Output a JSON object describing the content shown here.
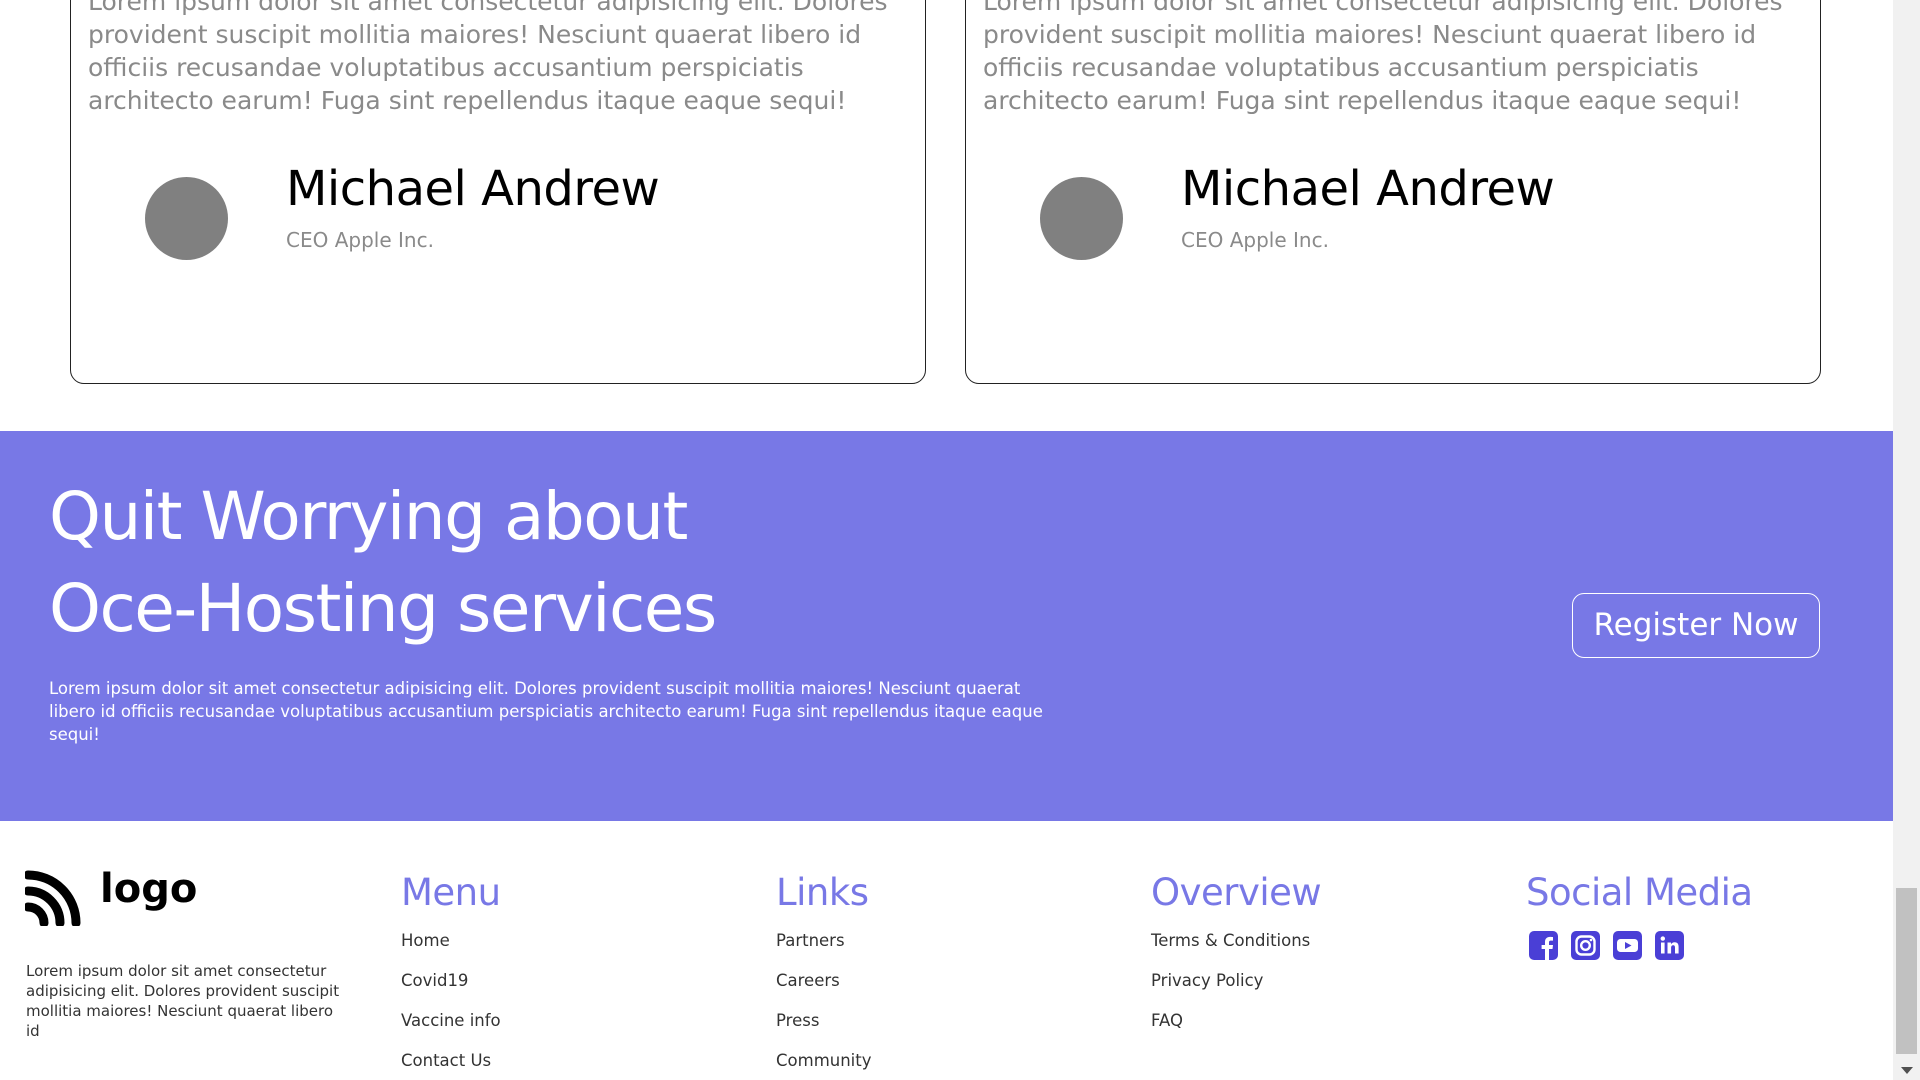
{
  "testimonials": [
    {
      "quote": "Lorem ipsum dolor sit amet consectetur adipisicing elit. Dolores provident suscipit mollitia maiores! Nesciunt quaerat libero id officiis recusandae voluptatibus accusantium perspiciatis architecto earum! Fuga sint repellendus itaque eaque sequi!",
      "name": "Michael Andrew",
      "role": "CEO Apple Inc."
    },
    {
      "quote": "Lorem ipsum dolor sit amet consectetur adipisicing elit. Dolores provident suscipit mollitia maiores! Nesciunt quaerat libero id officiis recusandae voluptatibus accusantium perspiciatis architecto earum! Fuga sint repellendus itaque eaque sequi!",
      "name": "Michael Andrew",
      "role": "CEO Apple Inc."
    }
  ],
  "cta": {
    "heading_line1": "Quit Worrying about",
    "heading_line2": "Oce-Hosting services",
    "description": "Lorem ipsum dolor sit amet consectetur adipisicing elit. Dolores provident suscipit mollitia maiores! Nesciunt quaerat libero id officiis recusandae voluptatibus accusantium perspiciatis architecto earum! Fuga sint repellendus itaque eaque sequi!",
    "button_label": "Register Now",
    "background_color": "#7878e6"
  },
  "footer": {
    "brand_name": "logo",
    "brand_icon": "rss-feed-icon",
    "brand_description": "Lorem ipsum dolor sit amet consectetur adipisicing elit. Dolores provident suscipit mollitia maiores! Nesciunt quaerat libero id",
    "accent_color": "#7878e6",
    "columns": {
      "menu": {
        "title": "Menu",
        "items": [
          "Home",
          "Covid19",
          "Vaccine info",
          "Contact Us"
        ]
      },
      "links": {
        "title": "Links",
        "items": [
          "Partners",
          "Careers",
          "Press",
          "Community"
        ]
      },
      "overview": {
        "title": "Overview",
        "items": [
          "Terms & Conditions",
          "Privacy Policy",
          "FAQ"
        ]
      },
      "social": {
        "title": "Social Media",
        "icons": [
          "facebook-icon",
          "instagram-icon",
          "youtube-icon",
          "linkedin-icon"
        ]
      }
    }
  }
}
